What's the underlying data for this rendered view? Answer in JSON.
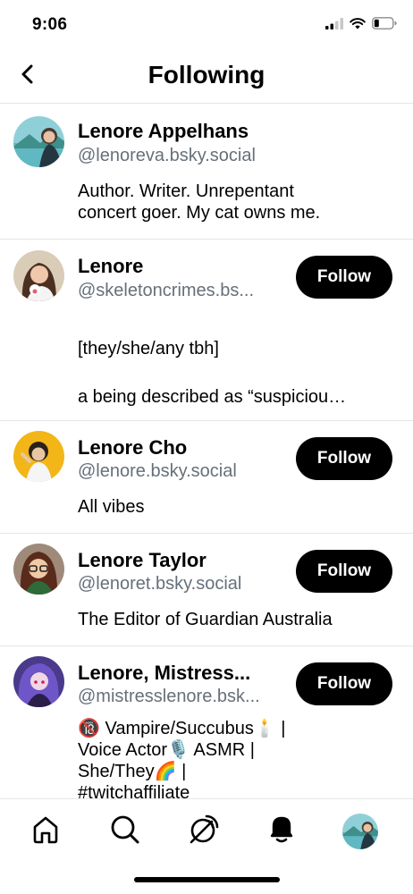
{
  "status": {
    "time": "9:06",
    "icons": [
      "cellular-signal-icon",
      "wifi-icon",
      "battery-icon"
    ]
  },
  "header": {
    "title": "Following",
    "back_icon": "chevron-left-icon"
  },
  "follow_label": "Follow",
  "users": [
    {
      "name": "Lenore Appelhans",
      "handle": "@lenoreva.bsky.social",
      "bio_lines": [
        "Author. Writer. Unrepentant",
        "concert goer. My cat owns me."
      ],
      "show_follow": false
    },
    {
      "name": "Lenore",
      "handle": "@skeletoncrimes.bs...",
      "bio_lines": [
        "[they/she/any tbh]",
        "a being described as “suspiciou…"
      ],
      "show_follow": true
    },
    {
      "name": "Lenore Cho",
      "handle": "@lenore.bsky.social",
      "bio_lines": [
        "All vibes"
      ],
      "show_follow": true
    },
    {
      "name": "Lenore Taylor",
      "handle": "@lenoret.bsky.social",
      "bio_lines": [
        "The Editor of Guardian Australia"
      ],
      "show_follow": true
    },
    {
      "name": "Lenore, Mistress...",
      "handle": "@mistresslenore.bsk...",
      "bio_lines": [
        "🔞 Vampire/Succubus🕯️ |",
        "Voice Actor🎙️ ASMR |",
        "She/They🌈 |",
        "#twitchaffiliate"
      ],
      "show_follow": true
    }
  ],
  "tabs": [
    {
      "name": "home",
      "icon": "home-icon"
    },
    {
      "name": "search",
      "icon": "search-icon"
    },
    {
      "name": "feeds",
      "icon": "feeds-icon"
    },
    {
      "name": "notifications",
      "icon": "bell-icon"
    },
    {
      "name": "profile",
      "icon": "profile-avatar-icon"
    }
  ],
  "colors": {
    "text": "#000000",
    "secondary": "#66707a",
    "button_bg": "#000000",
    "button_text": "#ffffff",
    "divider": "#e6e6e6"
  }
}
